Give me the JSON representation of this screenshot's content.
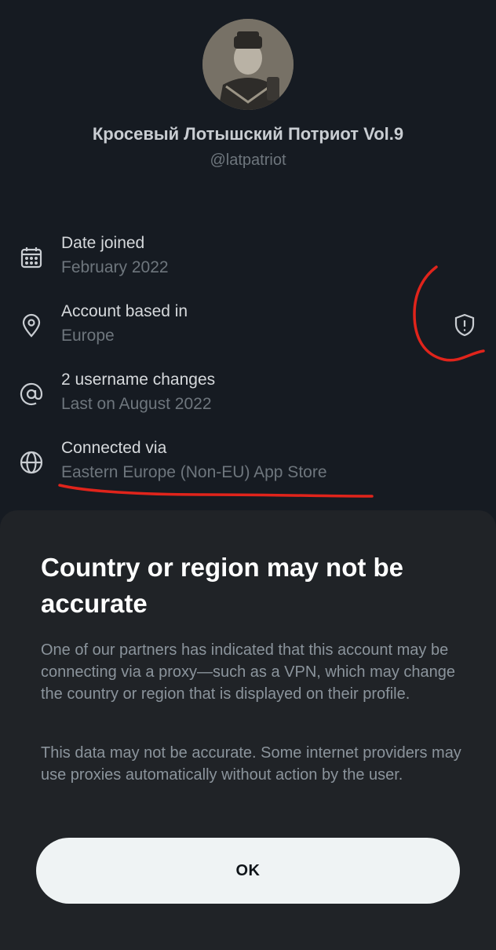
{
  "profile": {
    "display_name": "Кросевый Лотышский Потриот Vol.9",
    "handle": "@latpatriot",
    "avatar_icon": "avatar-photo"
  },
  "info": [
    {
      "icon": "calendar-icon",
      "label": "Date joined",
      "value": "February 2022"
    },
    {
      "icon": "location-pin-icon",
      "label": "Account based in",
      "value": "Europe"
    },
    {
      "icon": "at-sign-icon",
      "label": "2 username changes",
      "value": "Last on August 2022"
    },
    {
      "icon": "globe-icon",
      "label": "Connected via",
      "value": "Eastern Europe (Non-EU) App Store"
    }
  ],
  "location_warning_icon": "shield-alert-icon",
  "sheet": {
    "title": "Country or region may not be accurate",
    "paragraph1": "One of our partners has indicated that this account may be connecting via a proxy—such as a VPN, which may change the country or region that is displayed on their profile.",
    "paragraph2": "This data may not be accurate. Some internet providers may use proxies automatically without action by the user.",
    "ok_label": "OK"
  },
  "colors": {
    "background": "#161b22",
    "sheet_background": "#202327",
    "annotation_red": "#e0241b",
    "button_background": "#eff3f4"
  }
}
